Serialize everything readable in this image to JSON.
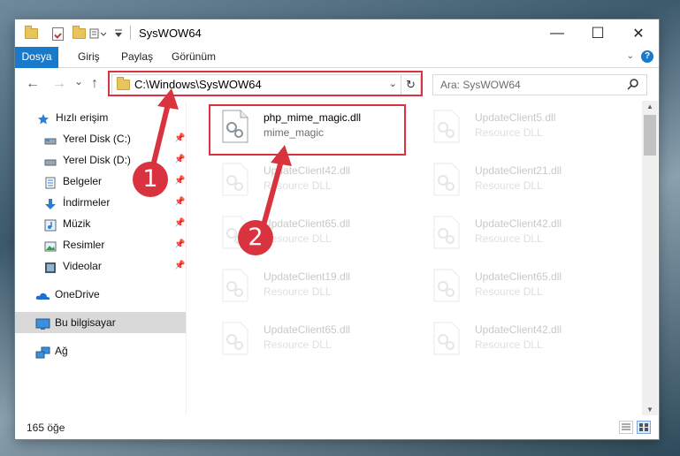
{
  "window": {
    "title": "SysWOW64",
    "minimize": "—",
    "maximize": "☐",
    "close": "✕"
  },
  "ribbon": {
    "tabs": [
      "Dosya",
      "Giriş",
      "Paylaş",
      "Görünüm"
    ],
    "help": "?"
  },
  "nav": {
    "back": "←",
    "forward": "→",
    "recent": "⌄",
    "up": "↑",
    "address": "C:\\Windows\\SysWOW64",
    "address_dropdown": "⌄",
    "refresh": "↻",
    "search_placeholder": "Ara: SysWOW64"
  },
  "sidebar": {
    "items": [
      {
        "label": "Hızlı erişim",
        "icon": "star-icon"
      },
      {
        "label": "Yerel Disk (C:)",
        "icon": "drive-icon",
        "pinned": true
      },
      {
        "label": "Yerel Disk (D:)",
        "icon": "drive-icon",
        "pinned": true
      },
      {
        "label": "Belgeler",
        "icon": "documents-icon",
        "pinned": true
      },
      {
        "label": "İndirmeler",
        "icon": "download-icon",
        "pinned": true
      },
      {
        "label": "Müzik",
        "icon": "music-icon",
        "pinned": true
      },
      {
        "label": "Resimler",
        "icon": "pictures-icon",
        "pinned": true
      },
      {
        "label": "Videolar",
        "icon": "videos-icon",
        "pinned": true
      },
      {
        "label": "OneDrive",
        "icon": "onedrive-icon"
      },
      {
        "label": "Bu bilgisayar",
        "icon": "computer-icon",
        "selected": true
      },
      {
        "label": "Ağ",
        "icon": "network-icon"
      }
    ],
    "pin_glyph": "📌"
  },
  "files": [
    {
      "name": "php_mime_magic.dll",
      "type": "mime_magic",
      "highlighted": true
    },
    {
      "name": "UpdateClient5.dll",
      "type": "Resource DLL"
    },
    {
      "name": "UpdateClient42.dll",
      "type": "Resource DLL"
    },
    {
      "name": "UpdateClient21.dll",
      "type": "Resource DLL"
    },
    {
      "name": "UpdateClient65.dll",
      "type": "Resource DLL"
    },
    {
      "name": "UpdateClient42.dll",
      "type": "Resource DLL"
    },
    {
      "name": "UpdateClient19.dll",
      "type": "Resource DLL"
    },
    {
      "name": "UpdateClient65.dll",
      "type": "Resource DLL"
    },
    {
      "name": "UpdateClient65.dll",
      "type": "Resource DLL"
    },
    {
      "name": "UpdateClient42.dll",
      "type": "Resource DLL"
    }
  ],
  "status": {
    "count": "165 öğe"
  },
  "callouts": [
    "1",
    "2"
  ],
  "colors": {
    "accent": "#1979ca",
    "highlight": "#d9333f",
    "selected": "#d9d9d9"
  }
}
